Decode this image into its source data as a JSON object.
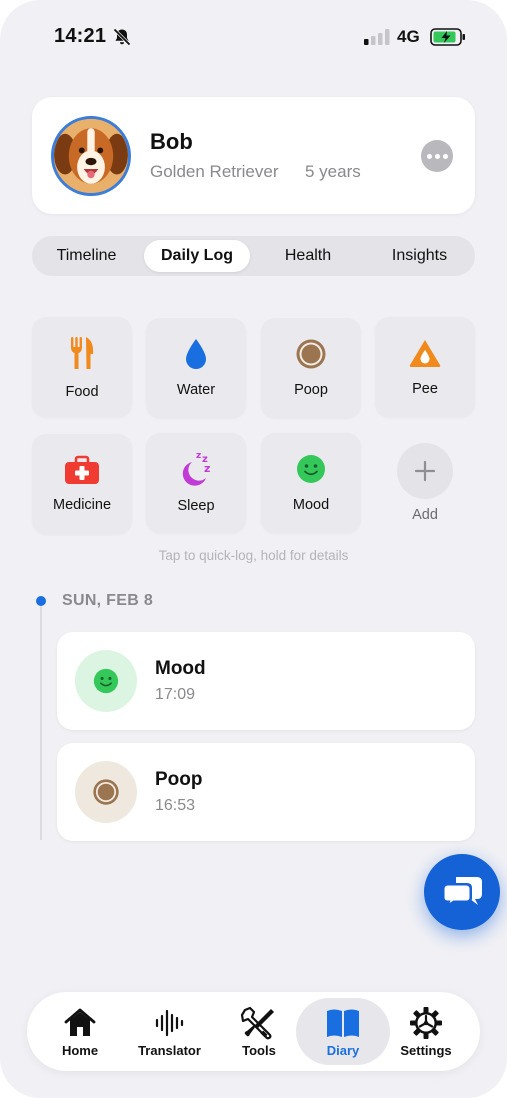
{
  "status_bar": {
    "time": "14:21",
    "network": "4G"
  },
  "profile": {
    "name": "Bob",
    "breed": "Golden Retriever",
    "age": "5 years"
  },
  "tabs": [
    {
      "label": "Timeline"
    },
    {
      "label": "Daily Log"
    },
    {
      "label": "Health"
    },
    {
      "label": "Insights"
    }
  ],
  "active_tab": "Daily Log",
  "quick_log": {
    "items": [
      {
        "label": "Food",
        "icon": "fork-knife-icon"
      },
      {
        "label": "Water",
        "icon": "water-drop-icon"
      },
      {
        "label": "Poop",
        "icon": "poop-circle-icon"
      },
      {
        "label": "Pee",
        "icon": "pee-triangle-icon"
      },
      {
        "label": "Medicine",
        "icon": "medical-kit-icon"
      },
      {
        "label": "Sleep",
        "icon": "moon-zzz-icon"
      },
      {
        "label": "Mood",
        "icon": "smiley-icon"
      }
    ],
    "add_label": "Add",
    "hint": "Tap to quick-log, hold for details"
  },
  "timeline": {
    "date": "SUN, FEB 8",
    "entries": [
      {
        "title": "Mood",
        "time": "17:09",
        "icon": "smiley-icon"
      },
      {
        "title": "Poop",
        "time": "16:53",
        "icon": "poop-circle-icon"
      }
    ]
  },
  "nav": {
    "items": [
      {
        "label": "Home",
        "icon": "home-icon"
      },
      {
        "label": "Translator",
        "icon": "waveform-icon"
      },
      {
        "label": "Tools",
        "icon": "tools-icon"
      },
      {
        "label": "Diary",
        "icon": "book-icon"
      },
      {
        "label": "Settings",
        "icon": "gear-icon"
      }
    ],
    "active": "Diary"
  },
  "colors": {
    "accent": "#1a6fe0",
    "food": "#f08a1c",
    "water": "#1a6fe0",
    "poop": "#9b7450",
    "pee": "#f08a1c",
    "medicine": "#ef3b32",
    "sleep": "#c23ad6",
    "mood": "#34c759",
    "fab": "#1462d6"
  }
}
